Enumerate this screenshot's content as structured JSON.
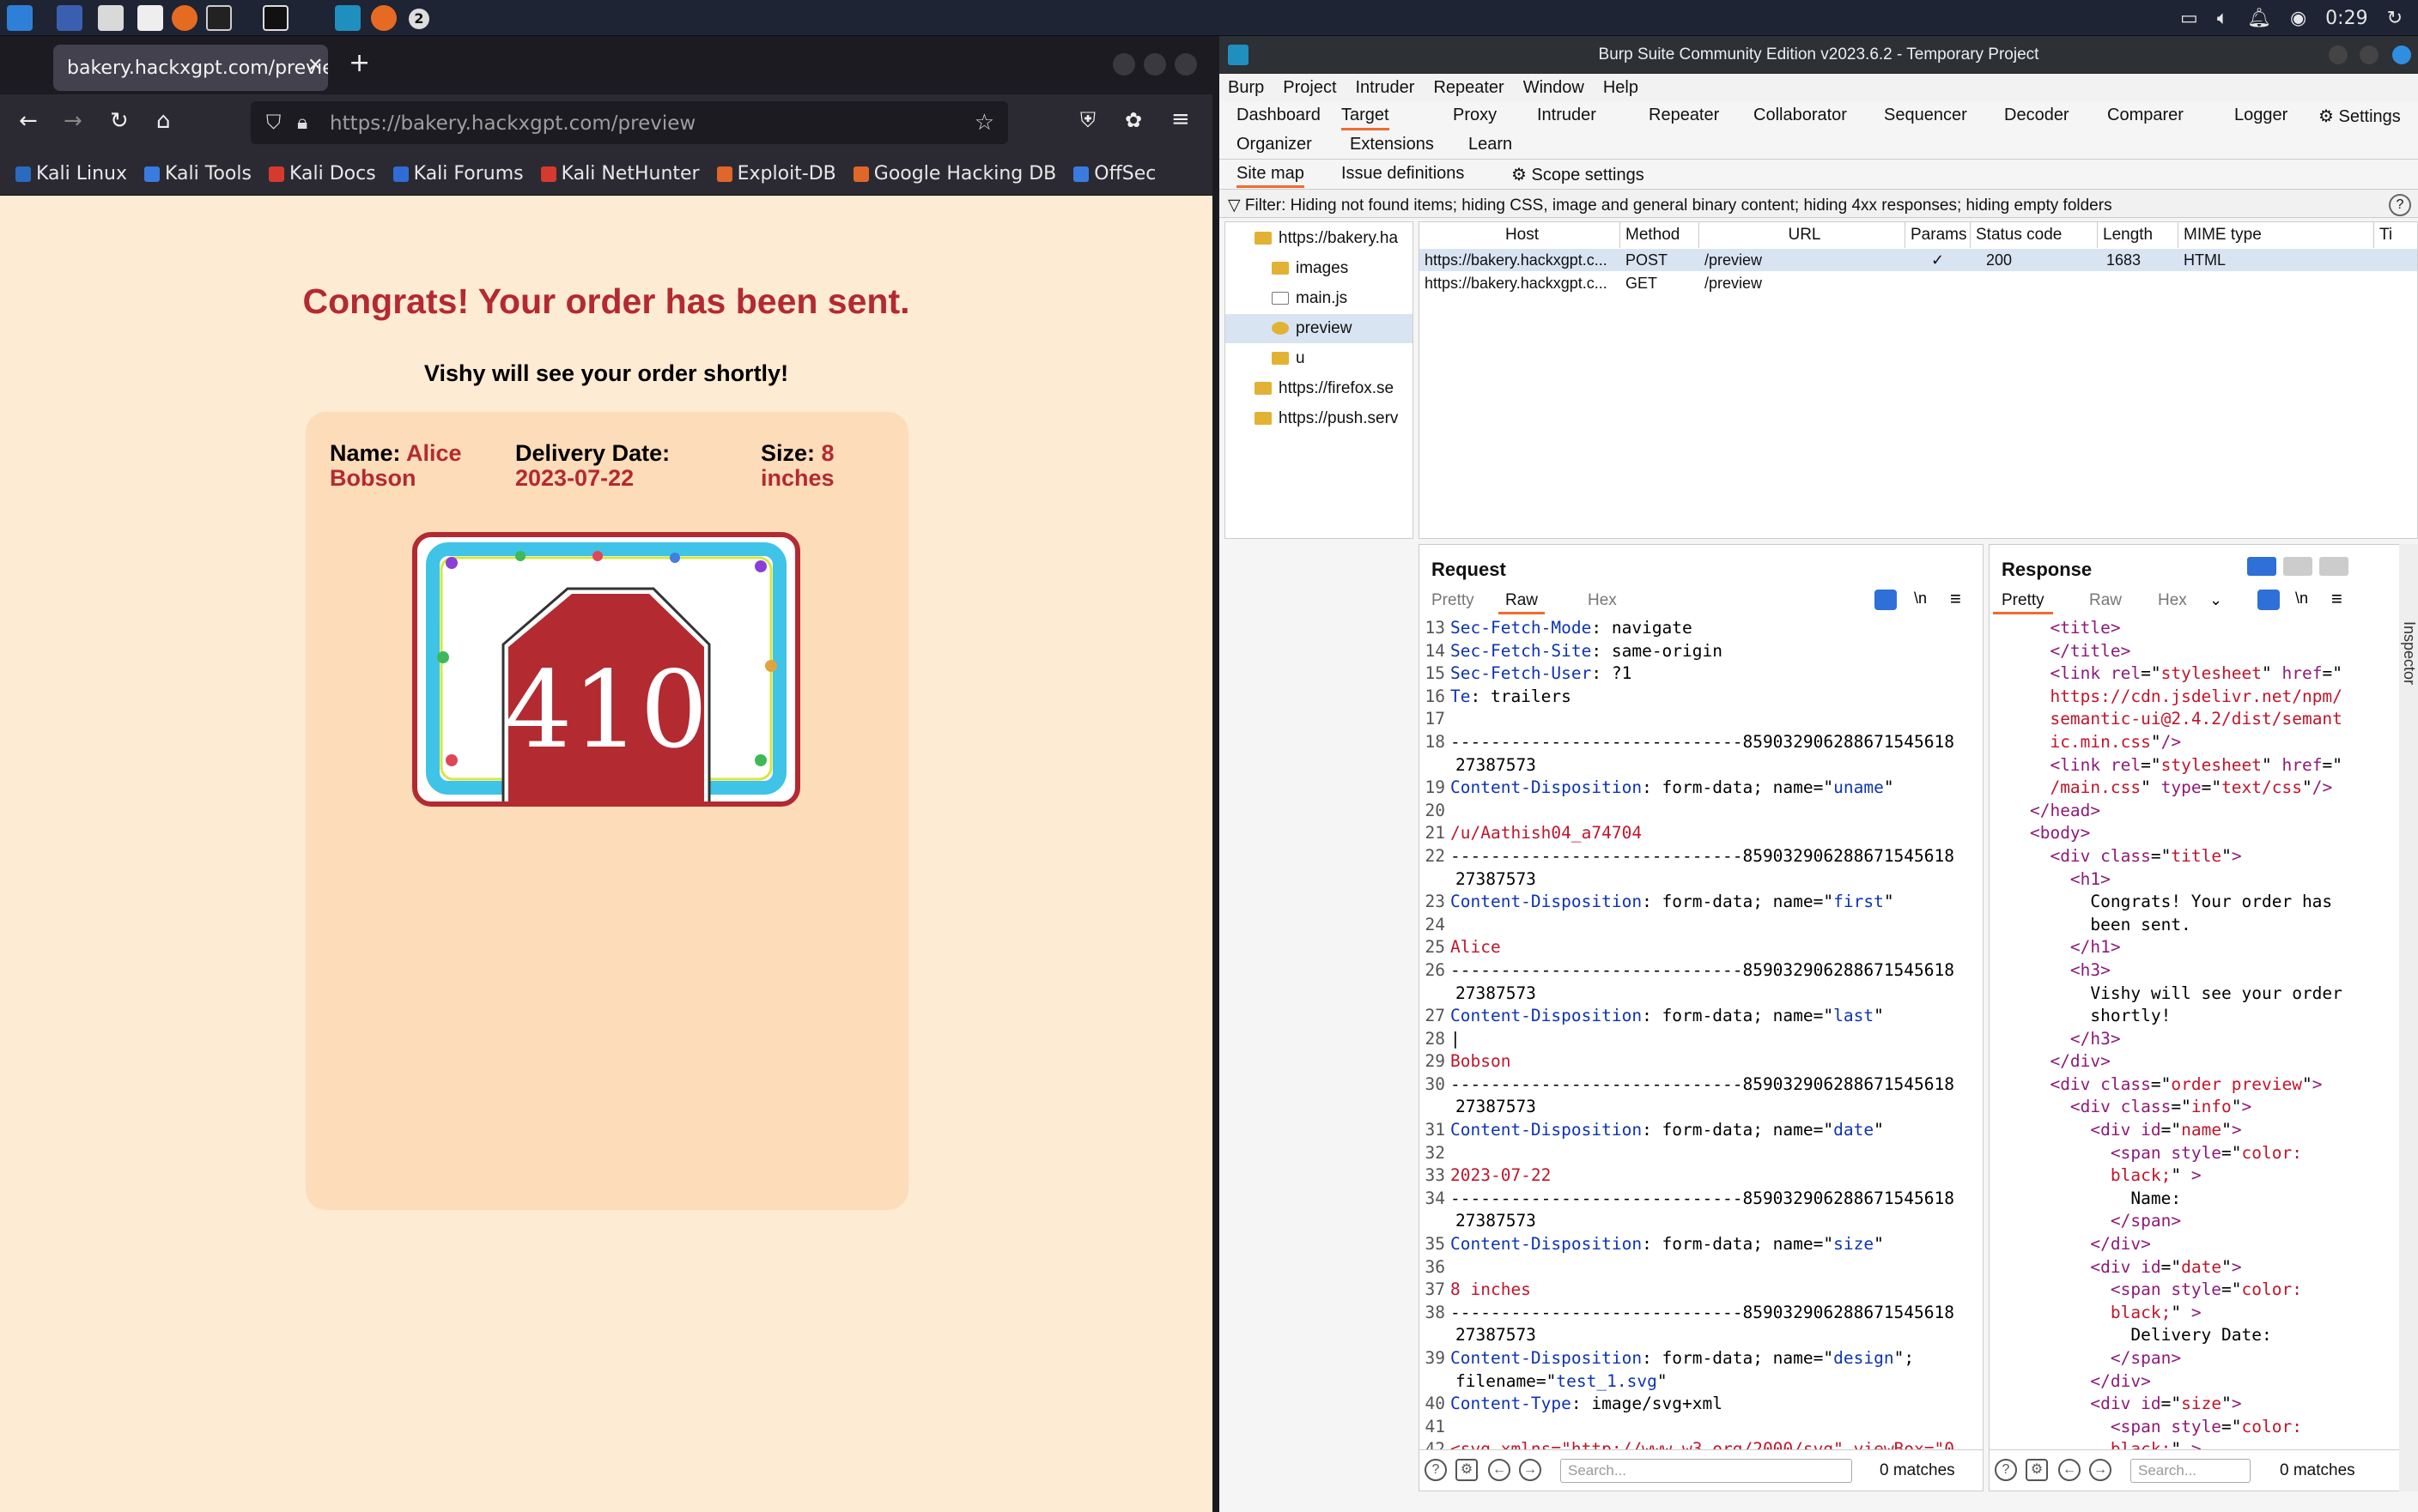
{
  "taskbar": {
    "clock": "0:29",
    "badge": "2"
  },
  "firefox": {
    "tab_title": "bakery.hackxgpt.com/preview",
    "new_tab": "+",
    "url": "https://bakery.hackxgpt.com/preview",
    "bookmarks": [
      "Kali Linux",
      "Kali Tools",
      "Kali Docs",
      "Kali Forums",
      "Kali NetHunter",
      "Exploit-DB",
      "Google Hacking DB",
      "OffSec"
    ]
  },
  "page": {
    "heading": "Congrats! Your order has been sent.",
    "subheading": "Vishy will see your order shortly!",
    "name_label": "Name:",
    "name_first": "Alice",
    "name_last": "Bobson",
    "date_label": "Delivery Date:",
    "date_value": "2023-07-22",
    "size_label": "Size:",
    "size_value_num": "8",
    "size_value_unit": "inches",
    "cake_text": "410"
  },
  "burp": {
    "title": "Burp Suite Community Edition v2023.6.2 - Temporary Project",
    "menu": [
      "Burp",
      "Project",
      "Intruder",
      "Repeater",
      "Window",
      "Help"
    ],
    "tabs1": [
      "Dashboard",
      "Target",
      "Proxy",
      "Intruder",
      "Repeater",
      "Collaborator",
      "Sequencer",
      "Decoder",
      "Comparer",
      "Logger",
      "Settings"
    ],
    "tabs2": [
      "Organizer",
      "Extensions",
      "Learn"
    ],
    "subtabs": [
      "Site map",
      "Issue definitions",
      "Scope settings"
    ],
    "filter": "Filter: Hiding not found items;  hiding CSS, image and general binary content;  hiding 4xx responses;  hiding empty folders",
    "tree": [
      {
        "label": "https://bakery.ha",
        "icon": "folder-icon"
      },
      {
        "label": "images",
        "icon": "folder-icon"
      },
      {
        "label": "main.js",
        "icon": "file-icon"
      },
      {
        "label": "preview",
        "icon": "gear-icon"
      },
      {
        "label": "u",
        "icon": "folder-icon"
      },
      {
        "label": "https://firefox.se",
        "icon": "folder-icon"
      },
      {
        "label": "https://push.serv",
        "icon": "folder-icon"
      }
    ],
    "table": {
      "columns": [
        "Host",
        "Method",
        "URL",
        "Params",
        "Status code",
        "Length",
        "MIME type",
        "Ti"
      ],
      "rows": [
        {
          "host": "https://bakery.hackxgpt.c...",
          "method": "POST",
          "url": "/preview",
          "params": "✓",
          "status": "200",
          "length": "1683",
          "mime": "HTML"
        },
        {
          "host": "https://bakery.hackxgpt.c...",
          "method": "GET",
          "url": "/preview",
          "params": "",
          "status": "",
          "length": "",
          "mime": ""
        }
      ]
    },
    "request": {
      "title": "Request",
      "tabs": [
        "Pretty",
        "Raw",
        "Hex"
      ],
      "search_placeholder": "Search...",
      "matches": "0 matches"
    },
    "response": {
      "title": "Response",
      "tabs": [
        "Pretty",
        "Raw",
        "Hex"
      ],
      "search_placeholder": "Search...",
      "matches": "0 matches"
    },
    "inspector": "Inspector"
  }
}
